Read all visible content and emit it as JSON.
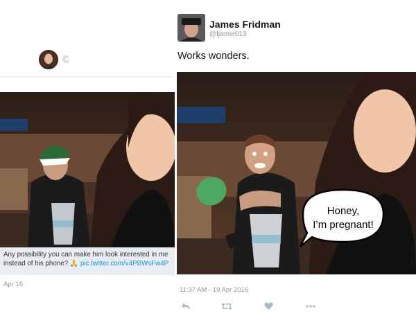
{
  "original_tweet": {
    "name": "C",
    "caption": "Any possibility you can make him look interested in me instead of his phone?",
    "link": "pic.twitter.com/v4PBWsFw4P",
    "date": "Apr 15"
  },
  "reply_tweet": {
    "author_name": "James Fridman",
    "handle": "@fjamie013",
    "text": "Works wonders.",
    "speech_bubble": [
      "Honey,",
      "I’m pregnant!"
    ],
    "timestamp": "11:37 AM - 19 Apr 2016"
  },
  "icons": {
    "reply": "reply-icon",
    "retweet": "retweet-icon",
    "like": "heart-icon",
    "more": "more-icon"
  },
  "colors": {
    "link": "#1b95e0",
    "muted": "#8899a6",
    "caption_bg": "#e8edf1",
    "action_icon": "#aab8c2"
  }
}
